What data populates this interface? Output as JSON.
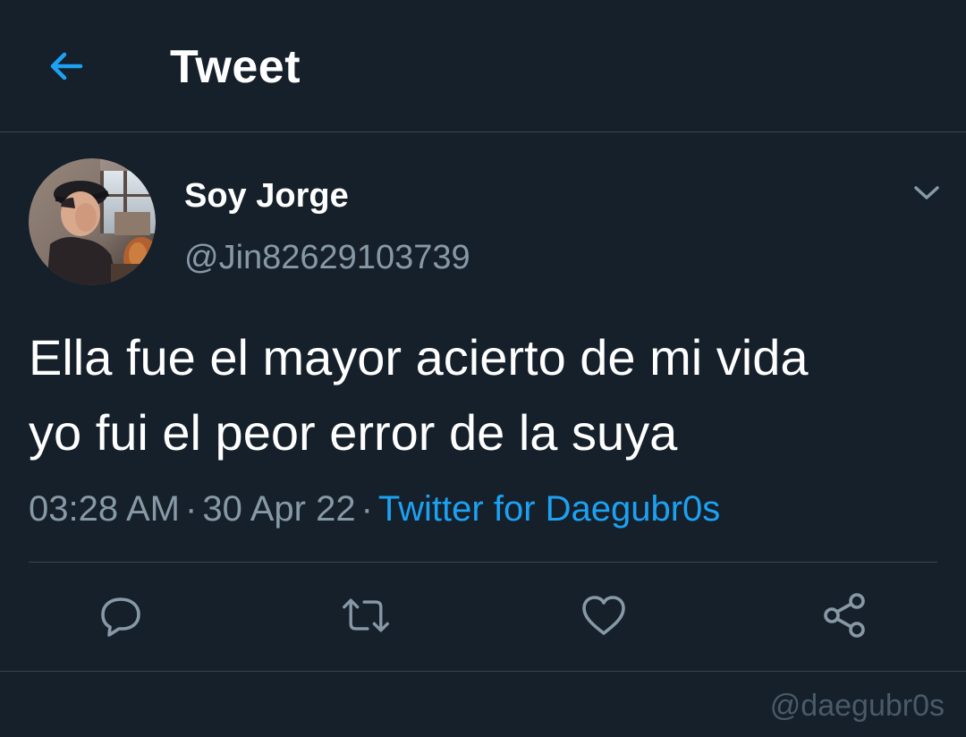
{
  "header": {
    "title": "Tweet",
    "back_icon": "arrow-left-icon"
  },
  "author": {
    "display_name": "Soy Jorge",
    "handle": "@Jin82629103739",
    "avatar": "profile-photo"
  },
  "tweet": {
    "text_lines": [
      "Ella fue el mayor acierto de mi vida",
      "yo fui el peor error de la suya"
    ],
    "time": "03:28 AM",
    "separator": "·",
    "date": "30 Apr 22",
    "source": "Twitter for Daegubr0s"
  },
  "actions": {
    "reply_icon": "reply-icon",
    "retweet_icon": "retweet-icon",
    "like_icon": "heart-icon",
    "share_icon": "share-icon"
  },
  "watermark": "@daegubr0s",
  "colors": {
    "background": "#15202b",
    "accent": "#1da1f2",
    "secondary_text": "#8899a6",
    "divider": "#38444d"
  }
}
